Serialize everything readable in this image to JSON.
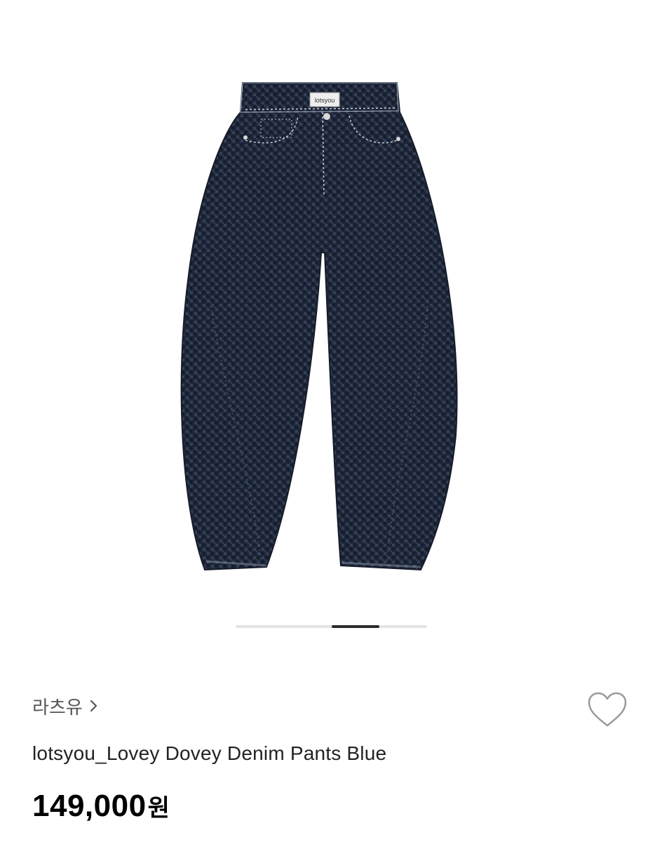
{
  "gallery": {
    "image_label": "lotsyou",
    "page_count": 4,
    "current_page": 3
  },
  "brand": {
    "name": "라츠유"
  },
  "product": {
    "name": "lotsyou_Lovey Dovey Denim Pants Blue",
    "price_amount": "149,000",
    "price_unit": "원"
  },
  "colors": {
    "denim": "#1e2738",
    "accent_text": "#000000",
    "secondary_text": "#555555",
    "heart_outline": "#9a9a9a"
  },
  "icons": {
    "brand_chevron": "chevron-right-icon",
    "like": "heart-outline-icon"
  }
}
